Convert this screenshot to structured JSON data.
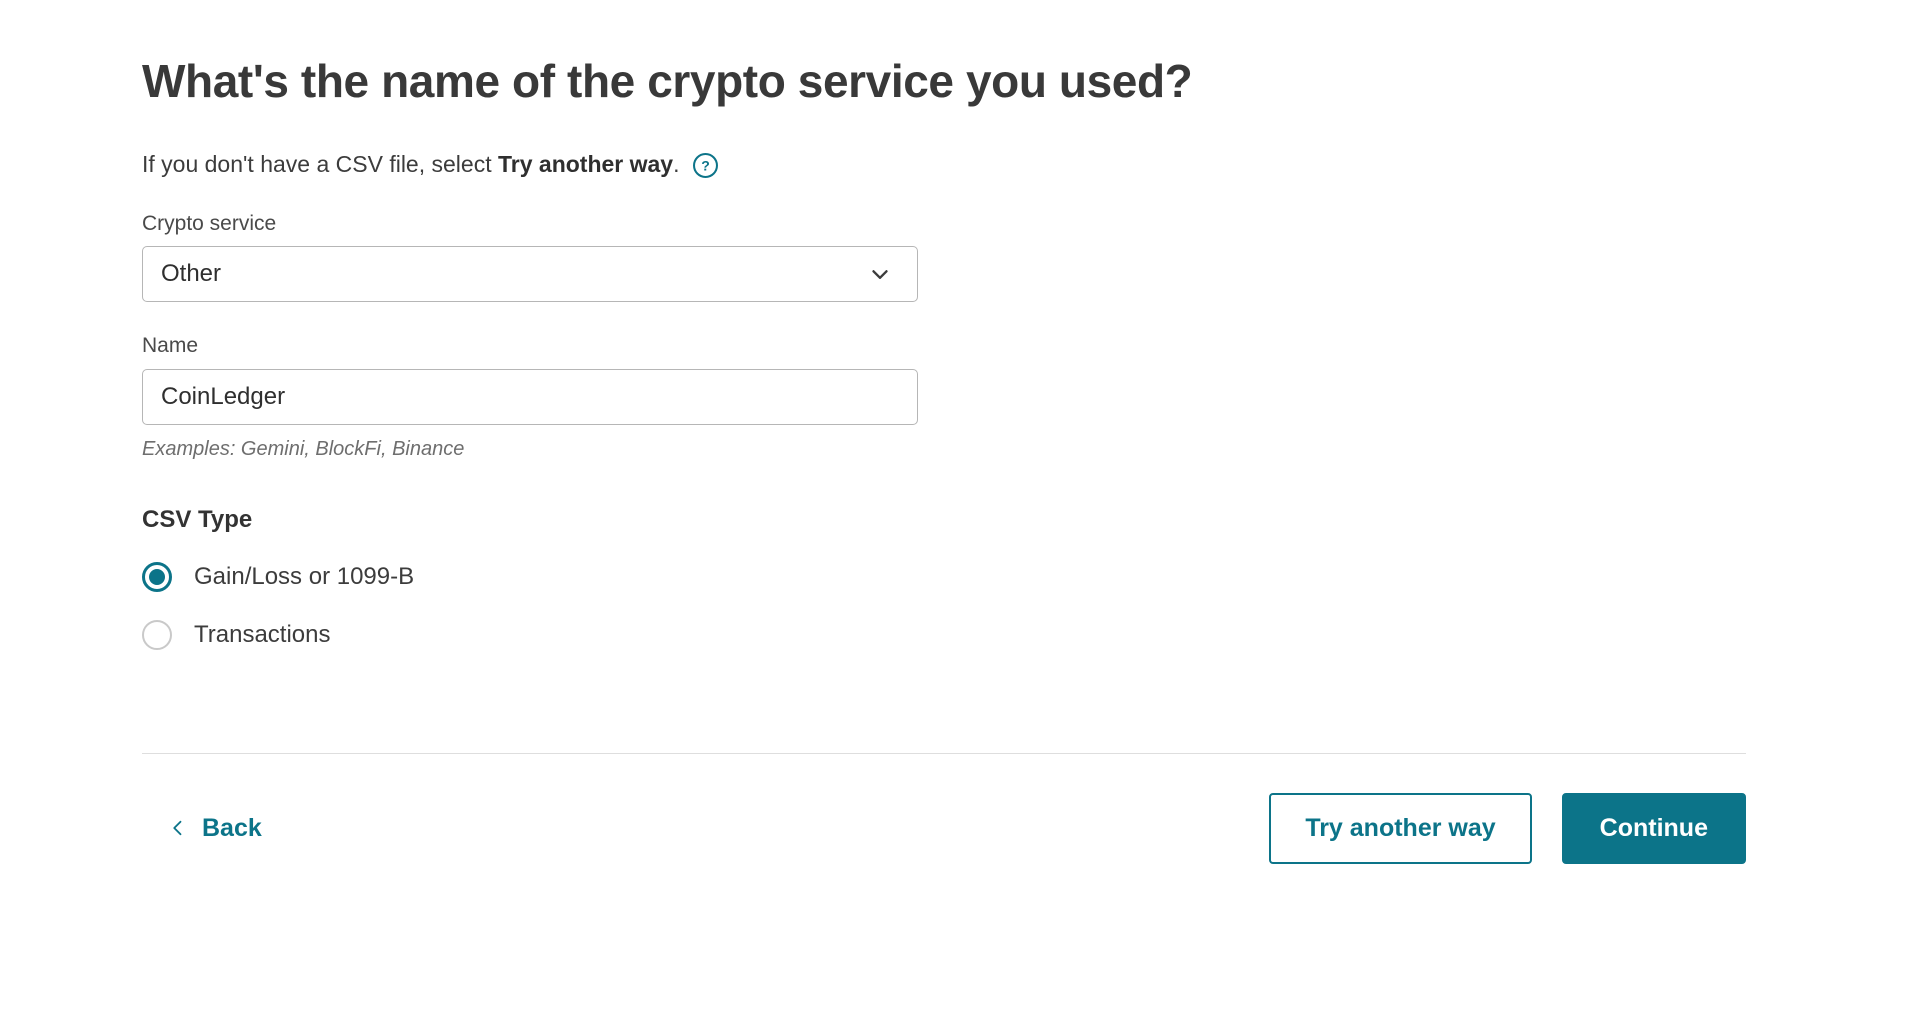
{
  "page": {
    "title": "What's the name of the crypto service you used?",
    "accent_color": "#0c7489",
    "text_color": "#3c3c3c"
  },
  "subtitle": {
    "text_before": "If you don't have a CSV file, select ",
    "emphasis": "Try another way",
    "text_after": ".",
    "help_icon": "help-circle-icon"
  },
  "form": {
    "crypto_service": {
      "label": "Crypto service",
      "value": "Other",
      "icon": "chevron-down-icon"
    },
    "name": {
      "label": "Name",
      "value": "CoinLedger",
      "placeholder": "",
      "helper": "Examples: Gemini, BlockFi, Binance"
    },
    "csv_type": {
      "label": "CSV Type",
      "options": [
        {
          "label": "Gain/Loss or 1099-B",
          "selected": true
        },
        {
          "label": "Transactions",
          "selected": false
        }
      ]
    }
  },
  "footer": {
    "back": {
      "label": "Back",
      "icon": "chevron-left-icon"
    },
    "try_another_way": "Try another way",
    "continue": "Continue"
  }
}
